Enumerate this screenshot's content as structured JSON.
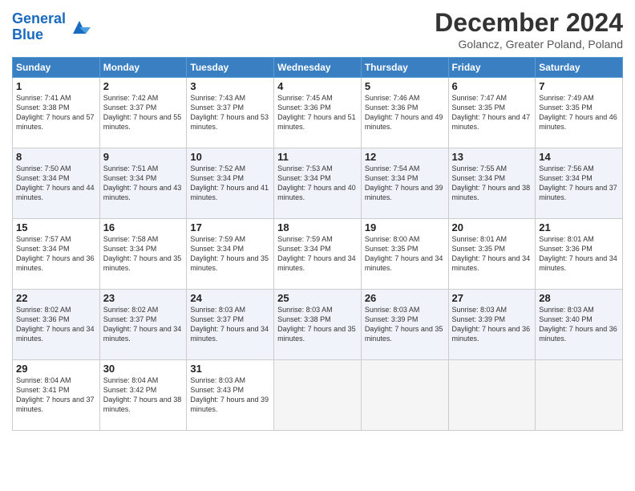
{
  "logo": {
    "line1": "General",
    "line2": "Blue"
  },
  "title": "December 2024",
  "location": "Golancz, Greater Poland, Poland",
  "weekdays": [
    "Sunday",
    "Monday",
    "Tuesday",
    "Wednesday",
    "Thursday",
    "Friday",
    "Saturday"
  ],
  "weeks": [
    [
      {
        "day": "1",
        "sunrise": "Sunrise: 7:41 AM",
        "sunset": "Sunset: 3:38 PM",
        "daylight": "Daylight: 7 hours and 57 minutes."
      },
      {
        "day": "2",
        "sunrise": "Sunrise: 7:42 AM",
        "sunset": "Sunset: 3:37 PM",
        "daylight": "Daylight: 7 hours and 55 minutes."
      },
      {
        "day": "3",
        "sunrise": "Sunrise: 7:43 AM",
        "sunset": "Sunset: 3:37 PM",
        "daylight": "Daylight: 7 hours and 53 minutes."
      },
      {
        "day": "4",
        "sunrise": "Sunrise: 7:45 AM",
        "sunset": "Sunset: 3:36 PM",
        "daylight": "Daylight: 7 hours and 51 minutes."
      },
      {
        "day": "5",
        "sunrise": "Sunrise: 7:46 AM",
        "sunset": "Sunset: 3:36 PM",
        "daylight": "Daylight: 7 hours and 49 minutes."
      },
      {
        "day": "6",
        "sunrise": "Sunrise: 7:47 AM",
        "sunset": "Sunset: 3:35 PM",
        "daylight": "Daylight: 7 hours and 47 minutes."
      },
      {
        "day": "7",
        "sunrise": "Sunrise: 7:49 AM",
        "sunset": "Sunset: 3:35 PM",
        "daylight": "Daylight: 7 hours and 46 minutes."
      }
    ],
    [
      {
        "day": "8",
        "sunrise": "Sunrise: 7:50 AM",
        "sunset": "Sunset: 3:34 PM",
        "daylight": "Daylight: 7 hours and 44 minutes."
      },
      {
        "day": "9",
        "sunrise": "Sunrise: 7:51 AM",
        "sunset": "Sunset: 3:34 PM",
        "daylight": "Daylight: 7 hours and 43 minutes."
      },
      {
        "day": "10",
        "sunrise": "Sunrise: 7:52 AM",
        "sunset": "Sunset: 3:34 PM",
        "daylight": "Daylight: 7 hours and 41 minutes."
      },
      {
        "day": "11",
        "sunrise": "Sunrise: 7:53 AM",
        "sunset": "Sunset: 3:34 PM",
        "daylight": "Daylight: 7 hours and 40 minutes."
      },
      {
        "day": "12",
        "sunrise": "Sunrise: 7:54 AM",
        "sunset": "Sunset: 3:34 PM",
        "daylight": "Daylight: 7 hours and 39 minutes."
      },
      {
        "day": "13",
        "sunrise": "Sunrise: 7:55 AM",
        "sunset": "Sunset: 3:34 PM",
        "daylight": "Daylight: 7 hours and 38 minutes."
      },
      {
        "day": "14",
        "sunrise": "Sunrise: 7:56 AM",
        "sunset": "Sunset: 3:34 PM",
        "daylight": "Daylight: 7 hours and 37 minutes."
      }
    ],
    [
      {
        "day": "15",
        "sunrise": "Sunrise: 7:57 AM",
        "sunset": "Sunset: 3:34 PM",
        "daylight": "Daylight: 7 hours and 36 minutes."
      },
      {
        "day": "16",
        "sunrise": "Sunrise: 7:58 AM",
        "sunset": "Sunset: 3:34 PM",
        "daylight": "Daylight: 7 hours and 35 minutes."
      },
      {
        "day": "17",
        "sunrise": "Sunrise: 7:59 AM",
        "sunset": "Sunset: 3:34 PM",
        "daylight": "Daylight: 7 hours and 35 minutes."
      },
      {
        "day": "18",
        "sunrise": "Sunrise: 7:59 AM",
        "sunset": "Sunset: 3:34 PM",
        "daylight": "Daylight: 7 hours and 34 minutes."
      },
      {
        "day": "19",
        "sunrise": "Sunrise: 8:00 AM",
        "sunset": "Sunset: 3:35 PM",
        "daylight": "Daylight: 7 hours and 34 minutes."
      },
      {
        "day": "20",
        "sunrise": "Sunrise: 8:01 AM",
        "sunset": "Sunset: 3:35 PM",
        "daylight": "Daylight: 7 hours and 34 minutes."
      },
      {
        "day": "21",
        "sunrise": "Sunrise: 8:01 AM",
        "sunset": "Sunset: 3:36 PM",
        "daylight": "Daylight: 7 hours and 34 minutes."
      }
    ],
    [
      {
        "day": "22",
        "sunrise": "Sunrise: 8:02 AM",
        "sunset": "Sunset: 3:36 PM",
        "daylight": "Daylight: 7 hours and 34 minutes."
      },
      {
        "day": "23",
        "sunrise": "Sunrise: 8:02 AM",
        "sunset": "Sunset: 3:37 PM",
        "daylight": "Daylight: 7 hours and 34 minutes."
      },
      {
        "day": "24",
        "sunrise": "Sunrise: 8:03 AM",
        "sunset": "Sunset: 3:37 PM",
        "daylight": "Daylight: 7 hours and 34 minutes."
      },
      {
        "day": "25",
        "sunrise": "Sunrise: 8:03 AM",
        "sunset": "Sunset: 3:38 PM",
        "daylight": "Daylight: 7 hours and 35 minutes."
      },
      {
        "day": "26",
        "sunrise": "Sunrise: 8:03 AM",
        "sunset": "Sunset: 3:39 PM",
        "daylight": "Daylight: 7 hours and 35 minutes."
      },
      {
        "day": "27",
        "sunrise": "Sunrise: 8:03 AM",
        "sunset": "Sunset: 3:39 PM",
        "daylight": "Daylight: 7 hours and 36 minutes."
      },
      {
        "day": "28",
        "sunrise": "Sunrise: 8:03 AM",
        "sunset": "Sunset: 3:40 PM",
        "daylight": "Daylight: 7 hours and 36 minutes."
      }
    ],
    [
      {
        "day": "29",
        "sunrise": "Sunrise: 8:04 AM",
        "sunset": "Sunset: 3:41 PM",
        "daylight": "Daylight: 7 hours and 37 minutes."
      },
      {
        "day": "30",
        "sunrise": "Sunrise: 8:04 AM",
        "sunset": "Sunset: 3:42 PM",
        "daylight": "Daylight: 7 hours and 38 minutes."
      },
      {
        "day": "31",
        "sunrise": "Sunrise: 8:03 AM",
        "sunset": "Sunset: 3:43 PM",
        "daylight": "Daylight: 7 hours and 39 minutes."
      },
      null,
      null,
      null,
      null
    ]
  ]
}
